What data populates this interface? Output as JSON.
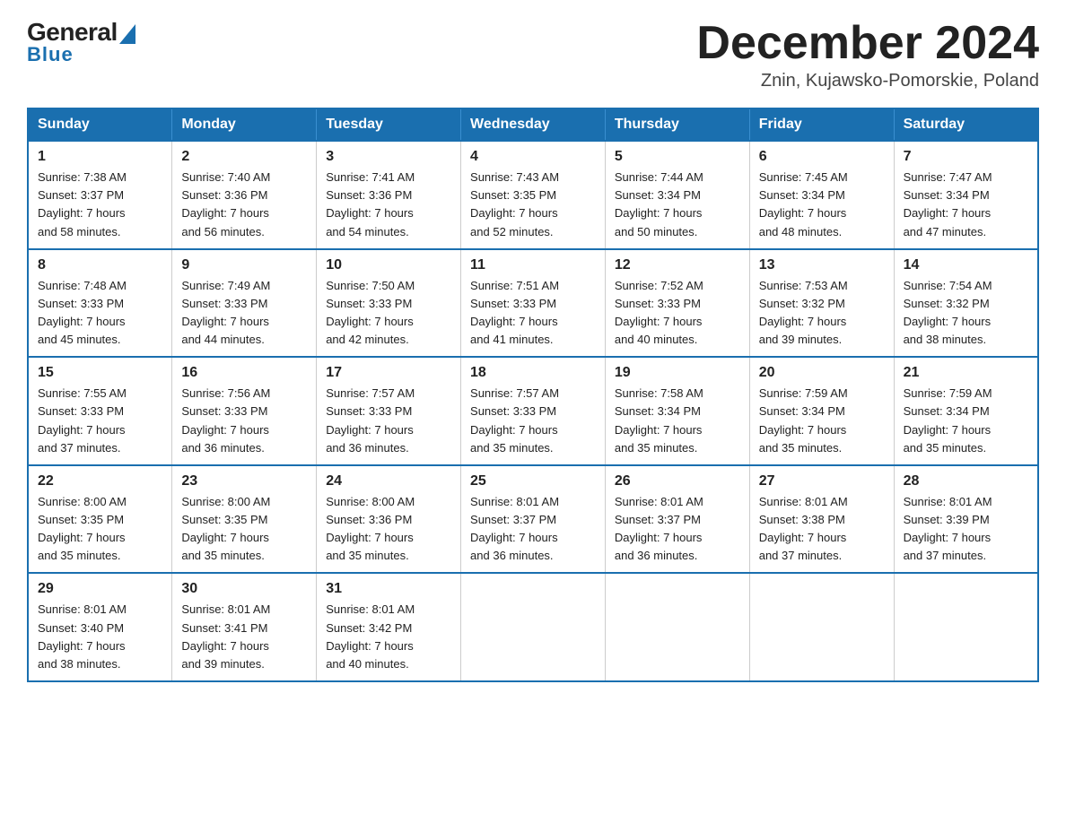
{
  "header": {
    "logo_text_general": "General",
    "logo_text_blue": "Blue",
    "month_title": "December 2024",
    "location": "Znin, Kujawsko-Pomorskie, Poland"
  },
  "days_of_week": [
    "Sunday",
    "Monday",
    "Tuesday",
    "Wednesday",
    "Thursday",
    "Friday",
    "Saturday"
  ],
  "weeks": [
    [
      {
        "day": "1",
        "sunrise": "7:38 AM",
        "sunset": "3:37 PM",
        "daylight": "7 hours and 58 minutes."
      },
      {
        "day": "2",
        "sunrise": "7:40 AM",
        "sunset": "3:36 PM",
        "daylight": "7 hours and 56 minutes."
      },
      {
        "day": "3",
        "sunrise": "7:41 AM",
        "sunset": "3:36 PM",
        "daylight": "7 hours and 54 minutes."
      },
      {
        "day": "4",
        "sunrise": "7:43 AM",
        "sunset": "3:35 PM",
        "daylight": "7 hours and 52 minutes."
      },
      {
        "day": "5",
        "sunrise": "7:44 AM",
        "sunset": "3:34 PM",
        "daylight": "7 hours and 50 minutes."
      },
      {
        "day": "6",
        "sunrise": "7:45 AM",
        "sunset": "3:34 PM",
        "daylight": "7 hours and 48 minutes."
      },
      {
        "day": "7",
        "sunrise": "7:47 AM",
        "sunset": "3:34 PM",
        "daylight": "7 hours and 47 minutes."
      }
    ],
    [
      {
        "day": "8",
        "sunrise": "7:48 AM",
        "sunset": "3:33 PM",
        "daylight": "7 hours and 45 minutes."
      },
      {
        "day": "9",
        "sunrise": "7:49 AM",
        "sunset": "3:33 PM",
        "daylight": "7 hours and 44 minutes."
      },
      {
        "day": "10",
        "sunrise": "7:50 AM",
        "sunset": "3:33 PM",
        "daylight": "7 hours and 42 minutes."
      },
      {
        "day": "11",
        "sunrise": "7:51 AM",
        "sunset": "3:33 PM",
        "daylight": "7 hours and 41 minutes."
      },
      {
        "day": "12",
        "sunrise": "7:52 AM",
        "sunset": "3:33 PM",
        "daylight": "7 hours and 40 minutes."
      },
      {
        "day": "13",
        "sunrise": "7:53 AM",
        "sunset": "3:32 PM",
        "daylight": "7 hours and 39 minutes."
      },
      {
        "day": "14",
        "sunrise": "7:54 AM",
        "sunset": "3:32 PM",
        "daylight": "7 hours and 38 minutes."
      }
    ],
    [
      {
        "day": "15",
        "sunrise": "7:55 AM",
        "sunset": "3:33 PM",
        "daylight": "7 hours and 37 minutes."
      },
      {
        "day": "16",
        "sunrise": "7:56 AM",
        "sunset": "3:33 PM",
        "daylight": "7 hours and 36 minutes."
      },
      {
        "day": "17",
        "sunrise": "7:57 AM",
        "sunset": "3:33 PM",
        "daylight": "7 hours and 36 minutes."
      },
      {
        "day": "18",
        "sunrise": "7:57 AM",
        "sunset": "3:33 PM",
        "daylight": "7 hours and 35 minutes."
      },
      {
        "day": "19",
        "sunrise": "7:58 AM",
        "sunset": "3:34 PM",
        "daylight": "7 hours and 35 minutes."
      },
      {
        "day": "20",
        "sunrise": "7:59 AM",
        "sunset": "3:34 PM",
        "daylight": "7 hours and 35 minutes."
      },
      {
        "day": "21",
        "sunrise": "7:59 AM",
        "sunset": "3:34 PM",
        "daylight": "7 hours and 35 minutes."
      }
    ],
    [
      {
        "day": "22",
        "sunrise": "8:00 AM",
        "sunset": "3:35 PM",
        "daylight": "7 hours and 35 minutes."
      },
      {
        "day": "23",
        "sunrise": "8:00 AM",
        "sunset": "3:35 PM",
        "daylight": "7 hours and 35 minutes."
      },
      {
        "day": "24",
        "sunrise": "8:00 AM",
        "sunset": "3:36 PM",
        "daylight": "7 hours and 35 minutes."
      },
      {
        "day": "25",
        "sunrise": "8:01 AM",
        "sunset": "3:37 PM",
        "daylight": "7 hours and 36 minutes."
      },
      {
        "day": "26",
        "sunrise": "8:01 AM",
        "sunset": "3:37 PM",
        "daylight": "7 hours and 36 minutes."
      },
      {
        "day": "27",
        "sunrise": "8:01 AM",
        "sunset": "3:38 PM",
        "daylight": "7 hours and 37 minutes."
      },
      {
        "day": "28",
        "sunrise": "8:01 AM",
        "sunset": "3:39 PM",
        "daylight": "7 hours and 37 minutes."
      }
    ],
    [
      {
        "day": "29",
        "sunrise": "8:01 AM",
        "sunset": "3:40 PM",
        "daylight": "7 hours and 38 minutes."
      },
      {
        "day": "30",
        "sunrise": "8:01 AM",
        "sunset": "3:41 PM",
        "daylight": "7 hours and 39 minutes."
      },
      {
        "day": "31",
        "sunrise": "8:01 AM",
        "sunset": "3:42 PM",
        "daylight": "7 hours and 40 minutes."
      },
      null,
      null,
      null,
      null
    ]
  ],
  "labels": {
    "sunrise": "Sunrise:",
    "sunset": "Sunset:",
    "daylight": "Daylight:"
  }
}
